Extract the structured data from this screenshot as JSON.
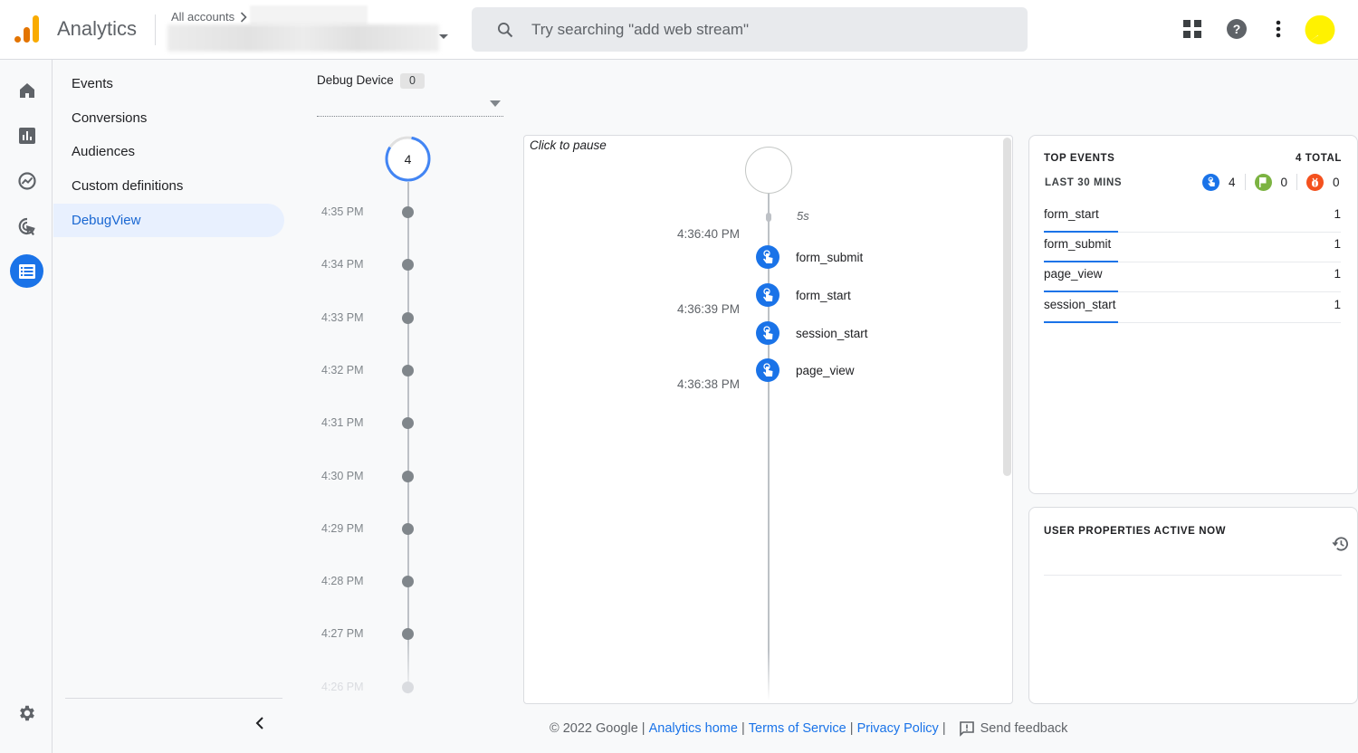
{
  "header": {
    "app_name": "Analytics",
    "breadcrumb_root": "All accounts",
    "search_placeholder": "Try searching \"add web stream\"",
    "icons": [
      "apps-grid-icon",
      "help-icon",
      "more-vert-icon",
      "account-avatar"
    ],
    "colors": {
      "logo_dark": "#e37400",
      "logo_light": "#f9ab00",
      "avatar": "#fff200"
    }
  },
  "rail": {
    "items": [
      {
        "name": "home",
        "icon": "home-icon",
        "active": false
      },
      {
        "name": "reports",
        "icon": "bar-chart-icon",
        "active": false
      },
      {
        "name": "explore",
        "icon": "explore-trend-icon",
        "active": false
      },
      {
        "name": "advertising",
        "icon": "cursor-click-icon",
        "active": false
      },
      {
        "name": "configure",
        "icon": "list-icon",
        "active": true
      }
    ],
    "settings_icon": "gear-icon"
  },
  "subnav": {
    "items": [
      {
        "label": "Events",
        "active": false
      },
      {
        "label": "Conversions",
        "active": false
      },
      {
        "label": "Audiences",
        "active": false
      },
      {
        "label": "Custom definitions",
        "active": false
      },
      {
        "label": "DebugView",
        "active": true
      }
    ]
  },
  "debug_device": {
    "label": "Debug Device",
    "count": "0",
    "selected": ""
  },
  "minutes": {
    "current_count": "4",
    "rows": [
      {
        "time": "4:35 PM",
        "faded": false
      },
      {
        "time": "4:34 PM",
        "faded": false
      },
      {
        "time": "4:33 PM",
        "faded": false
      },
      {
        "time": "4:32 PM",
        "faded": false
      },
      {
        "time": "4:31 PM",
        "faded": false
      },
      {
        "time": "4:30 PM",
        "faded": false
      },
      {
        "time": "4:29 PM",
        "faded": false
      },
      {
        "time": "4:28 PM",
        "faded": false
      },
      {
        "time": "4:27 PM",
        "faded": false
      },
      {
        "time": "4:26 PM",
        "faded": true
      }
    ]
  },
  "stream": {
    "pause_label": "Click to pause",
    "interval_label": "5s",
    "times": [
      "4:36:40 PM",
      "4:36:39 PM",
      "4:36:38 PM"
    ],
    "events": [
      {
        "name": "form_submit",
        "icon": "touch-icon"
      },
      {
        "name": "form_start",
        "icon": "touch-icon"
      },
      {
        "name": "session_start",
        "icon": "touch-icon"
      },
      {
        "name": "page_view",
        "icon": "touch-icon"
      }
    ]
  },
  "top_events": {
    "title": "TOP EVENTS",
    "total": "4 TOTAL",
    "period": "LAST 30 MINS",
    "counts": [
      {
        "type": "events",
        "icon": "touch-icon",
        "value": "4",
        "color": "#1a73e8"
      },
      {
        "type": "conversions",
        "icon": "flag-icon",
        "value": "0",
        "color": "#7cb342"
      },
      {
        "type": "errors",
        "icon": "bug-icon",
        "value": "0",
        "color": "#f4511e"
      }
    ],
    "rows": [
      {
        "name": "form_start",
        "value": "1"
      },
      {
        "name": "form_submit",
        "value": "1"
      },
      {
        "name": "page_view",
        "value": "1"
      },
      {
        "name": "session_start",
        "value": "1"
      }
    ]
  },
  "user_properties": {
    "title": "USER PROPERTIES ACTIVE NOW"
  },
  "footer": {
    "copyright": "© 2022 Google",
    "sep": " | ",
    "links": [
      "Analytics home",
      "Terms of Service",
      "Privacy Policy"
    ],
    "feedback": "Send feedback"
  }
}
